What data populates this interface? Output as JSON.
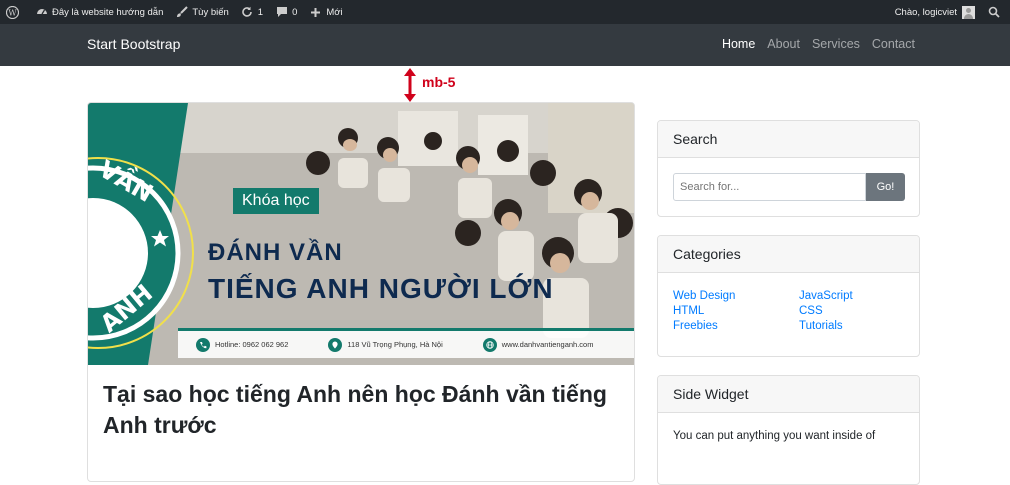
{
  "adminbar": {
    "site_name": "Đây là website hướng dẫn",
    "customize": "Tùy biến",
    "updates_count": "1",
    "comments_count": "0",
    "new_label": "Mới",
    "greeting": "Chào, logicviet"
  },
  "navbar": {
    "brand": "Start Bootstrap",
    "links": [
      "Home",
      "About",
      "Services",
      "Contact"
    ]
  },
  "annotation": {
    "label": "mb-5",
    "color": "#d0021b"
  },
  "post": {
    "image": {
      "badge": "Khóa học",
      "line1": "ĐÁNH VẦN",
      "line2": "TIẾNG ANH NGƯỜI LỚN",
      "hotline": "Hotline: 0962 062 962",
      "address": "118 Vũ Trọng Phụng, Hà Nội",
      "website": "www.danhvantienganh.com",
      "seal_text": "VẦN",
      "seal_text2": "ANH"
    },
    "title": "Tại sao học tiếng Anh nên học Đánh vần tiếng Anh trước"
  },
  "sidebar": {
    "search": {
      "title": "Search",
      "placeholder": "Search for...",
      "button": "Go!"
    },
    "categories": {
      "title": "Categories",
      "items": [
        "Web Design",
        "JavaScript",
        "HTML",
        "CSS",
        "Freebies",
        "Tutorials"
      ]
    },
    "side_widget": {
      "title": "Side Widget",
      "text": "You can put anything you want inside of"
    }
  },
  "colors": {
    "adminbar_bg": "#23282d",
    "navbar_bg": "#343a40",
    "link": "#007bff",
    "brand_green": "#137a6c"
  }
}
